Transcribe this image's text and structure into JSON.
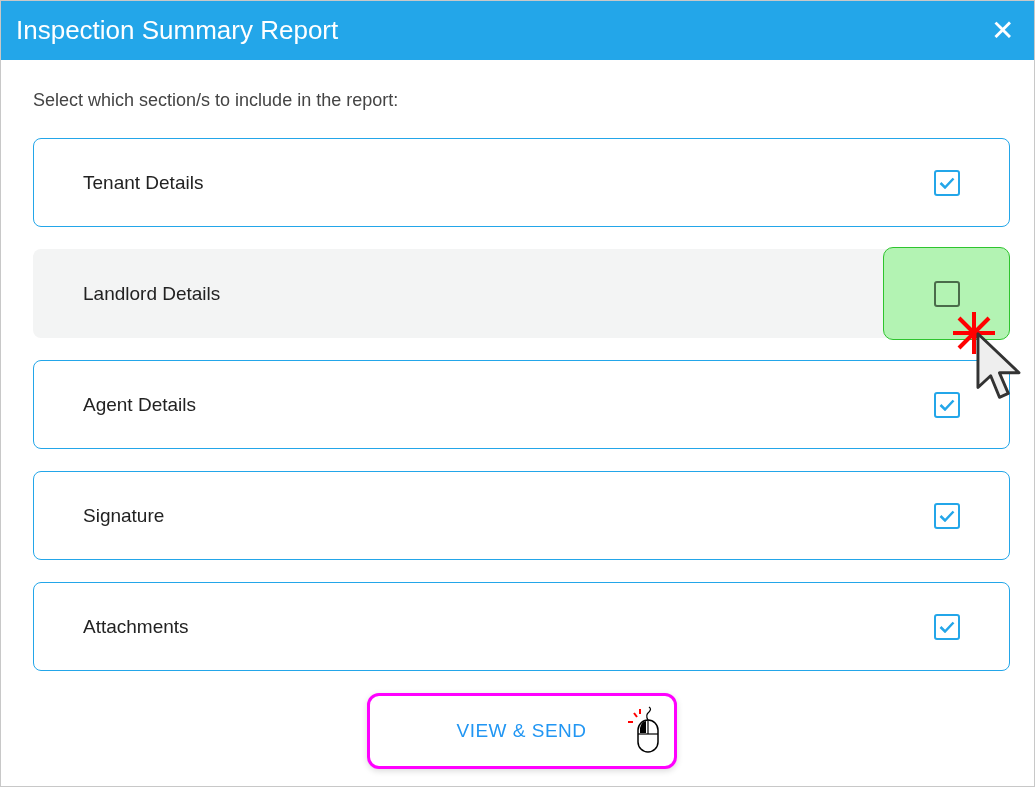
{
  "window": {
    "title": "Inspection Summary Report",
    "close": "✕"
  },
  "instruction": "Select which section/s to include in the report:",
  "sections": [
    {
      "label": "Tenant Details",
      "checked": true,
      "highlighted": false,
      "clicked": false
    },
    {
      "label": "Landlord Details",
      "checked": false,
      "highlighted": true,
      "clicked": true
    },
    {
      "label": "Agent Details",
      "checked": true,
      "highlighted": false,
      "clicked": false
    },
    {
      "label": "Signature",
      "checked": true,
      "highlighted": false,
      "clicked": false
    },
    {
      "label": "Attachments",
      "checked": true,
      "highlighted": false,
      "clicked": false
    }
  ],
  "button": {
    "label": "VIEW & SEND",
    "highlighted": true
  }
}
